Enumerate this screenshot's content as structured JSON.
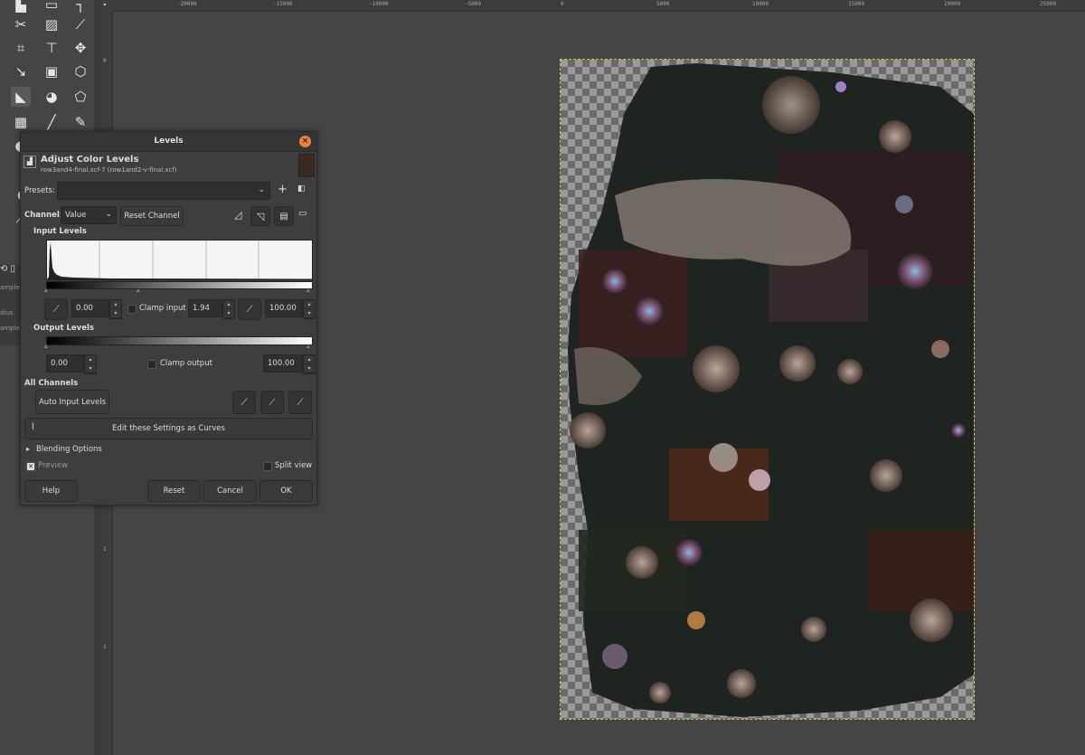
{
  "ruler_top_labels": [
    "-20000",
    "-15000",
    "-10000",
    "-5000",
    "0",
    "5000",
    "10000",
    "15000",
    "20000",
    "25000"
  ],
  "ruler_left_labels": [
    "0",
    "5",
    "1",
    "1",
    "1",
    "1",
    "1"
  ],
  "side_panel": {
    "items": [
      "ample",
      "dius",
      "ample"
    ]
  },
  "dialog": {
    "title": "Levels",
    "heading": "Adjust Color Levels",
    "subheading": "row3and4-final.xcf-7 (row1and2-v-final.xcf)",
    "presets_label": "Presets:",
    "presets_value": "",
    "channel_label": "Channel:",
    "channel_value": "Value",
    "reset_channel": "Reset Channel",
    "input_levels_label": "Input Levels",
    "input_low": "0.00",
    "clamp_input_label": "Clamp input",
    "gamma": "1.94",
    "input_high": "100.00",
    "output_levels_label": "Output Levels",
    "output_low": "0.00",
    "clamp_output_label": "Clamp output",
    "output_high": "100.00",
    "all_channels_label": "All Channels",
    "auto_input_levels": "Auto Input Levels",
    "edit_as_curves": "Edit these Settings as Curves",
    "blending_options": "Blending Options",
    "preview_label": "Preview",
    "split_view_label": "Split view",
    "help": "Help",
    "reset": "Reset",
    "cancel": "Cancel",
    "ok": "OK",
    "clamp_input_checked": false,
    "clamp_output_checked": false,
    "preview_checked": true,
    "split_view_checked": false
  },
  "colors": {
    "accent": "#e8803a",
    "selection_outline": "#d6c93a"
  }
}
